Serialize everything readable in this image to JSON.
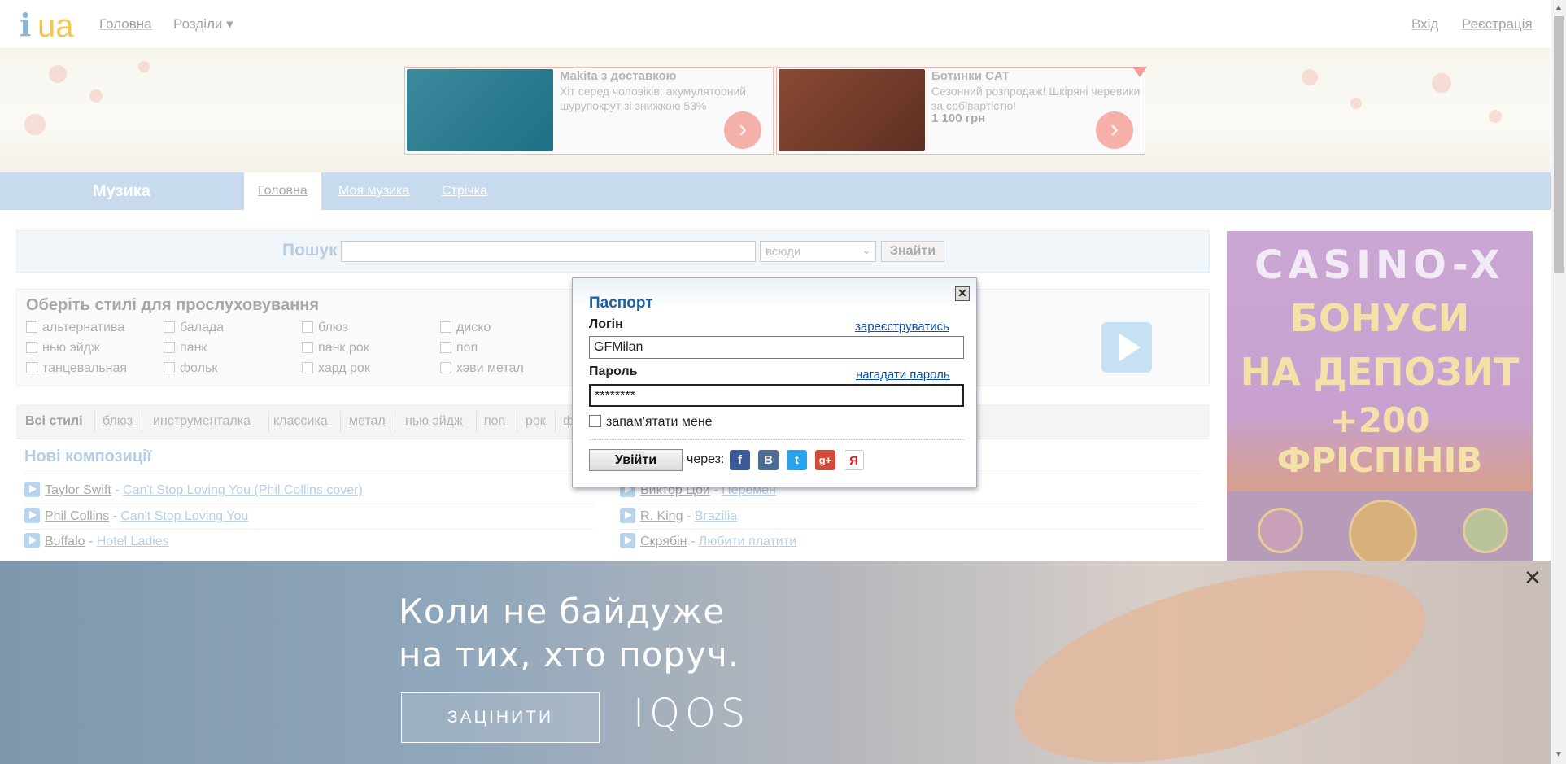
{
  "header": {
    "logo_text": "ua",
    "nav": [
      "Головна",
      "Розділи ▾"
    ],
    "login": "Вхід",
    "register": "Реєстрація"
  },
  "ads": [
    {
      "title": "Makita з доставкою",
      "text": "Хіт серед чоловіків: акумуляторний шурупокрут зі знижкою 53%",
      "price": ""
    },
    {
      "title": "Ботинки CAT",
      "text": "Сезонний розпродаж! Шкіряні черевики за собівартістю!",
      "price": "1 100 грн"
    }
  ],
  "music_nav": {
    "title": "Музика",
    "tabs": [
      "Головна",
      "Моя музика",
      "Стрічка"
    ]
  },
  "search": {
    "label": "Пошук",
    "value": "",
    "scope": "всюди",
    "button": "Знайти"
  },
  "styles": {
    "title": "Оберіть стилі для прослуховування",
    "items": [
      "альтернатива",
      "балада",
      "блюз",
      "диско",
      "нью эйдж",
      "панк",
      "панк рок",
      "поп",
      "танцевальная",
      "фольк",
      "хард рок",
      "хэви метал"
    ]
  },
  "genre_tabs": [
    "Всі стилі",
    "блюз",
    "инструменталка",
    "классика",
    "метал",
    "нью эйдж",
    "поп",
    "рок",
    "ф"
  ],
  "new_songs": {
    "title": "Нові композиції",
    "left": [
      {
        "artist": "Taylor Swift",
        "song": "Can't Stop Loving You (Phil Collins cover)"
      },
      {
        "artist": "Phil Collins",
        "song": "Can't Stop Loving You"
      },
      {
        "artist": "Buffalo",
        "song": "Hotel Ladies"
      }
    ],
    "right": [
      {
        "artist": "Виктор Цой",
        "song": "Перемен"
      },
      {
        "artist": "R. King",
        "song": "Brazilia"
      },
      {
        "artist": "Скрябін",
        "song": "Любити платити"
      }
    ]
  },
  "casino_ad": {
    "logo": "CASINO-X",
    "lines": [
      "БОНУСИ",
      "НА ДЕПОЗИТ",
      "+200 ФРІСПІНІВ"
    ]
  },
  "passport": {
    "title": "Паспорт",
    "login_label": "Логін",
    "register_link": "зареєструватись",
    "login_value": "GFMilan",
    "password_label": "Пароль",
    "remind_link": "нагадати пароль",
    "password_value": "********",
    "remember": "запам'ятати мене",
    "submit": "Увійти",
    "via": "через:",
    "social": [
      "f",
      "B",
      "t",
      "g+",
      "Я"
    ],
    "close": "✕"
  },
  "iqos_ad": {
    "line1": "Коли не байдуже",
    "line2": "на тих, хто поруч.",
    "button": "ЗАЦІНИТИ",
    "brand": "IQOS",
    "close": "✕"
  },
  "colors": {
    "accent": "#1d5ea5",
    "nav_bg": "#c7daee",
    "link": "#0b4fa8"
  }
}
